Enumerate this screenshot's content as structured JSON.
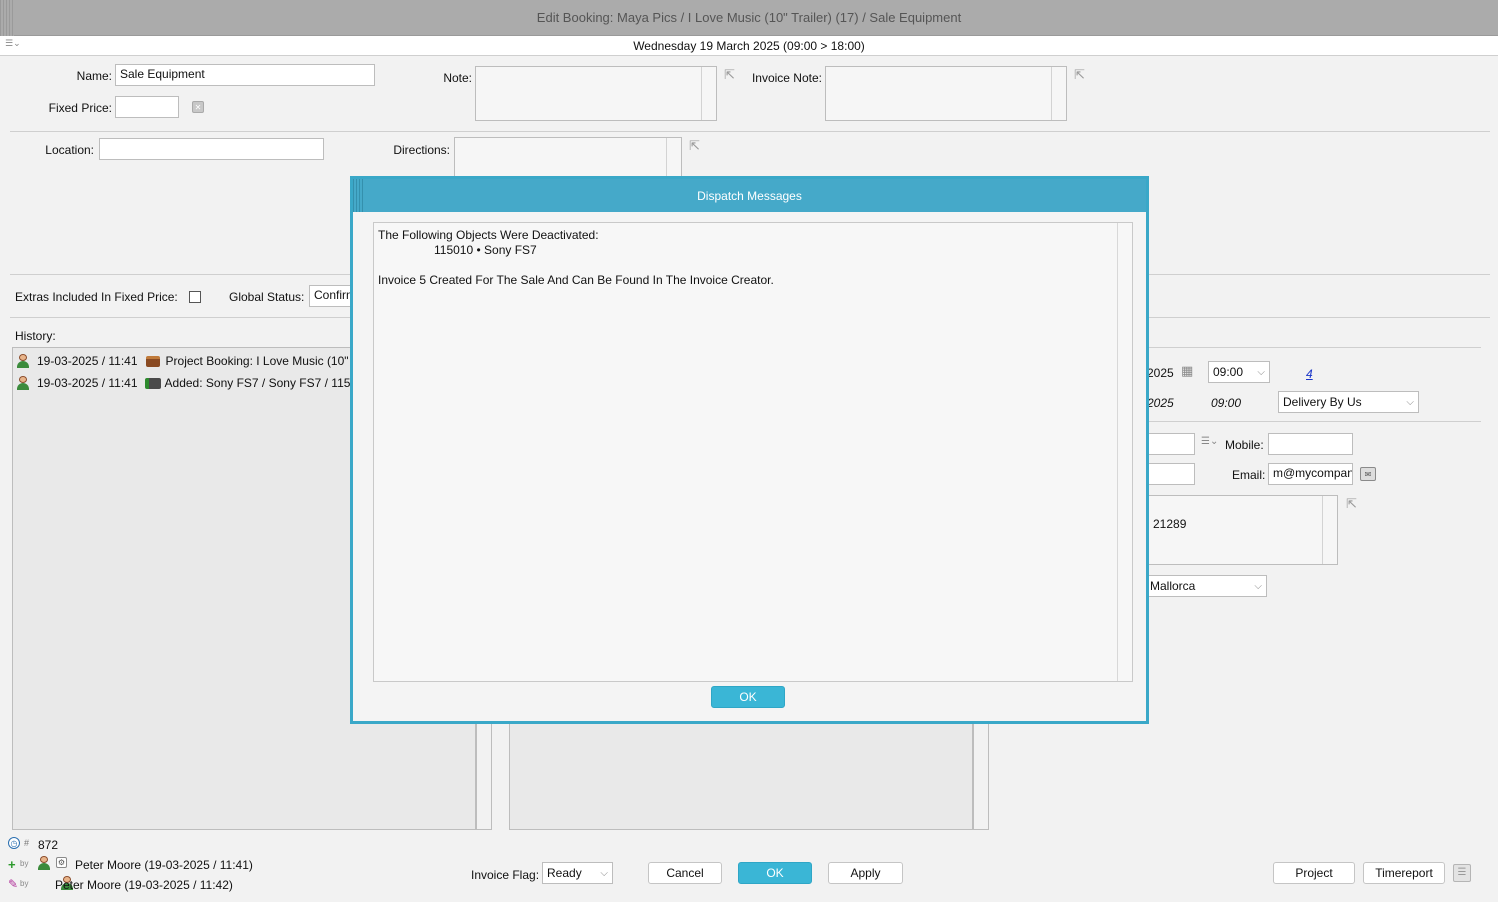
{
  "window": {
    "title": "Edit Booking: Maya Pics / I Love Music (10\" Trailer) (17) / Sale Equipment",
    "date_range": "Wednesday 19 March 2025 (09:00 > 18:00)"
  },
  "form": {
    "name_label": "Name:",
    "name_value": "Sale Equipment",
    "fixed_price_label": "Fixed Price:",
    "fixed_price_value": "",
    "note_label": "Note:",
    "invoice_note_label": "Invoice Note:",
    "location_label": "Location:",
    "location_value": "",
    "directions_label": "Directions:",
    "extras_label": "Extras Included In Fixed Price:",
    "global_status_label": "Global Status:",
    "global_status_value": "Confirm",
    "history_label": "History:"
  },
  "history": [
    {
      "timestamp": "19-03-2025 / 11:41",
      "text": "Project Booking: I Love Music (10\"",
      "icon": "briefcase-icon"
    },
    {
      "timestamp": "19-03-2025 / 11:41",
      "text": "Added: Sony FS7 / Sony FS7 / 115",
      "icon": "camera-icon"
    }
  ],
  "right_panel": {
    "date_fragment": "2025",
    "time_value": "09:00",
    "count_link": "4",
    "date_fragment_2": "2025",
    "time_value_2": "09:00",
    "delivery_value": "Delivery By Us",
    "mobile_label": "Mobile:",
    "mobile_value": "",
    "email_label": "Email:",
    "email_value": "m@mycompan",
    "address_fragment": "21289",
    "region_value": "Mallorca"
  },
  "footer": {
    "id_value": "872",
    "created_by": "Peter Moore (19-03-2025 / 11:41)",
    "modified_by": "Peter Moore (19-03-2025 / 11:42)",
    "by_tag": "by",
    "hash_tag": "#",
    "invoice_flag_label": "Invoice Flag:",
    "invoice_flag_value": "Ready",
    "cancel_label": "Cancel",
    "ok_label": "OK",
    "apply_label": "Apply",
    "project_label": "Project",
    "timereport_label": "Timereport"
  },
  "dialog": {
    "title": "Dispatch Messages",
    "line1": "The Following Objects Were Deactivated:",
    "line2": "115010 • Sony FS7",
    "line3": "Invoice 5 Created For The Sale And Can Be Found In The Invoice Creator.",
    "ok_label": "OK"
  },
  "colors": {
    "accent": "#3ab6d6",
    "dialog_header": "#45a9c9",
    "titlebar": "#ababab"
  }
}
